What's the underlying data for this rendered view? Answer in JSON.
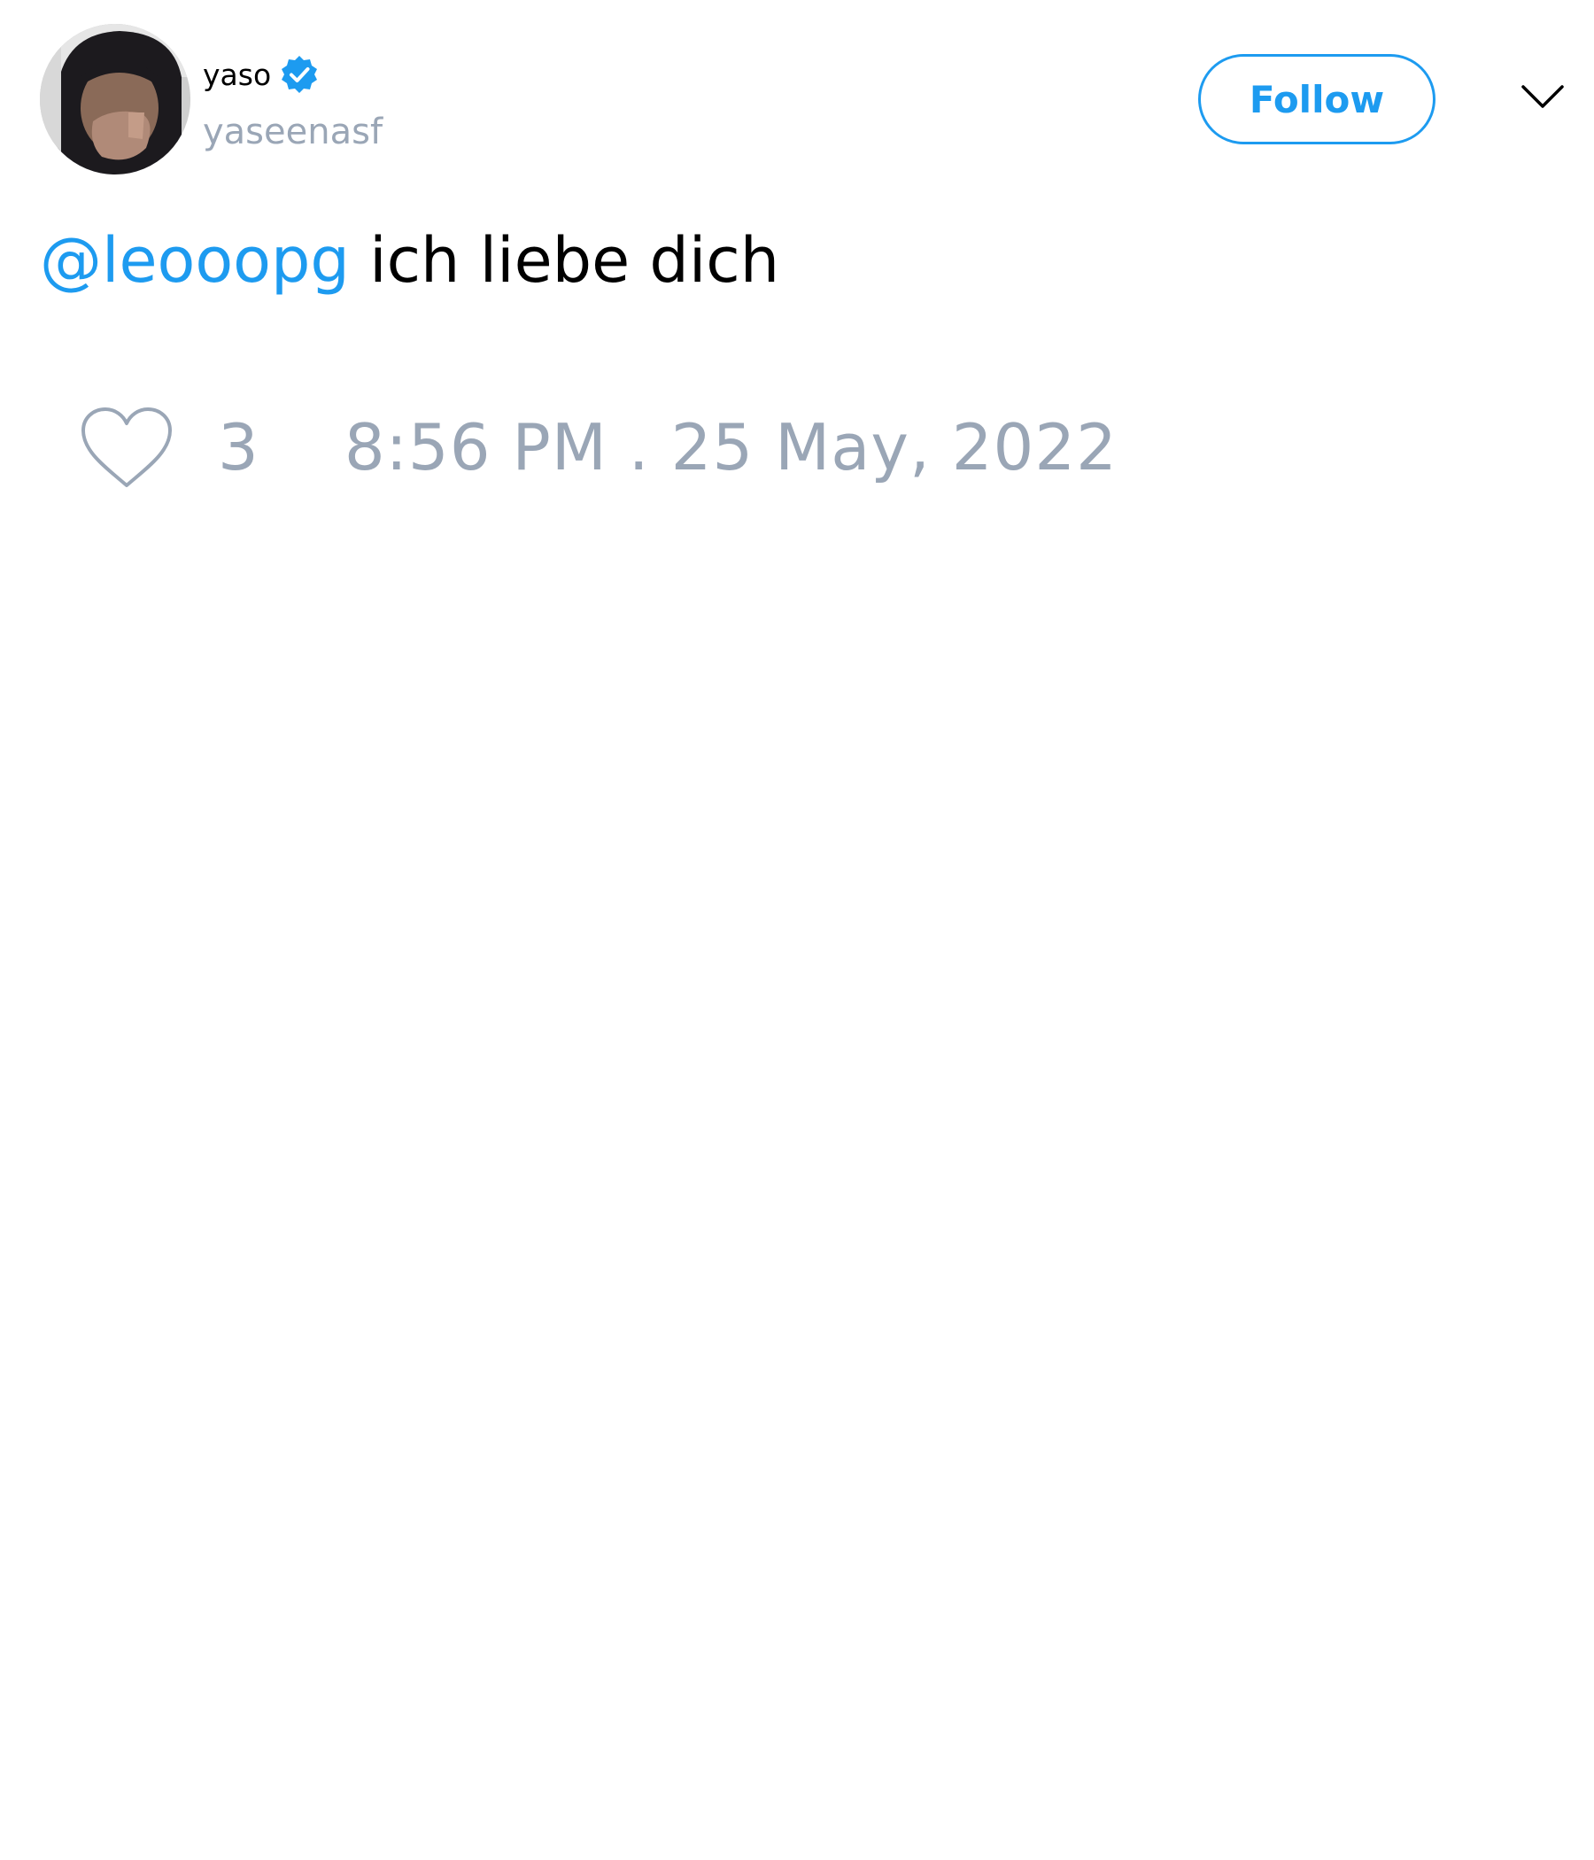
{
  "author": {
    "display_name": "yaso",
    "handle": "yaseenasf",
    "verified": true,
    "avatar_icon": "avatar-photo"
  },
  "actions": {
    "follow_label": "Follow",
    "menu_icon": "chevron-down-icon"
  },
  "tweet": {
    "mention": "@leooopg",
    "text": " ich liebe dich"
  },
  "footer": {
    "like_icon": "heart-outline-icon",
    "like_count": "3",
    "timestamp": "8:56 PM . 25 May, 2022"
  },
  "colors": {
    "accent": "#1d9bf0",
    "muted": "#9aa6b6",
    "text": "#000000",
    "background": "#ffffff"
  }
}
